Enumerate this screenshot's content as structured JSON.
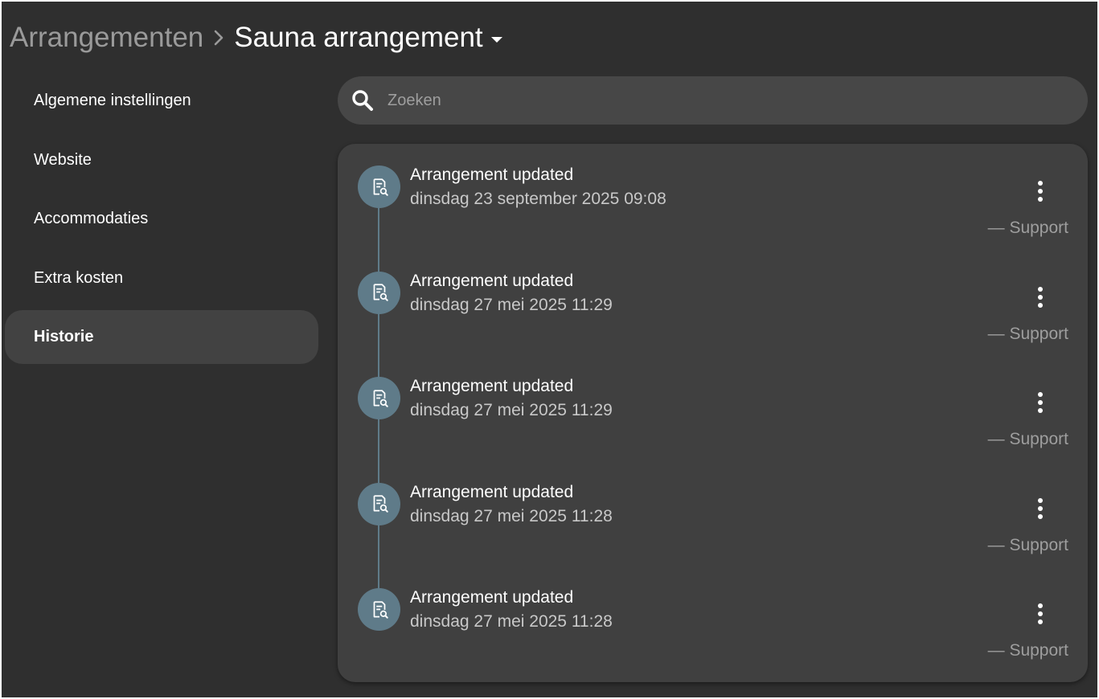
{
  "breadcrumb": {
    "parent": "Arrangementen",
    "separator": "›",
    "current": "Sauna arrangement"
  },
  "sidebar": {
    "items": [
      {
        "label": "Algemene instellingen",
        "active": false
      },
      {
        "label": "Website",
        "active": false
      },
      {
        "label": "Accommodaties",
        "active": false
      },
      {
        "label": "Extra kosten",
        "active": false
      },
      {
        "label": "Historie",
        "active": true
      }
    ]
  },
  "search": {
    "placeholder": "Zoeken",
    "value": "",
    "icon": "search-icon"
  },
  "history": {
    "entry_icon": "document-search-icon",
    "menu_icon": "more-vertical-icon",
    "entries": [
      {
        "title": "Arrangement updated",
        "date": "dinsdag 23 september 2025 09:08",
        "author": "— Support"
      },
      {
        "title": "Arrangement updated",
        "date": "dinsdag 27 mei 2025 11:29",
        "author": "— Support"
      },
      {
        "title": "Arrangement updated",
        "date": "dinsdag 27 mei 2025 11:29",
        "author": "— Support"
      },
      {
        "title": "Arrangement updated",
        "date": "dinsdag 27 mei 2025 11:28",
        "author": "— Support"
      },
      {
        "title": "Arrangement updated",
        "date": "dinsdag 27 mei 2025 11:28",
        "author": "— Support"
      }
    ]
  },
  "colors": {
    "background": "#2f2f2f",
    "panel": "#404040",
    "search_bg": "#474747",
    "active_item": "#424242",
    "timeline_accent": "#5f7b89",
    "text_primary": "#ffffff",
    "text_muted": "#9e9e9e"
  }
}
